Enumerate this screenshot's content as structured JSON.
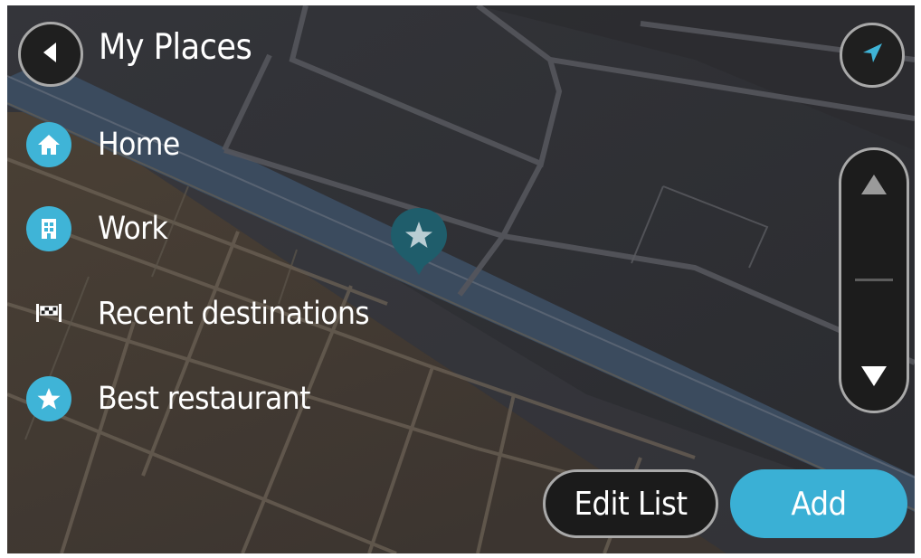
{
  "header": {
    "title": "My Places",
    "back_icon": "back-arrow-icon",
    "location_icon": "current-location-arrow-icon"
  },
  "list": {
    "items": [
      {
        "label": "Home",
        "icon": "home-icon"
      },
      {
        "label": "Work",
        "icon": "work-building-icon"
      },
      {
        "label": "Recent destinations",
        "icon": "checkered-flag-icon"
      },
      {
        "label": "Best restaurant",
        "icon": "star-icon"
      }
    ]
  },
  "scroll": {
    "up_icon": "scroll-up-arrow-icon",
    "down_icon": "scroll-down-arrow-icon"
  },
  "footer": {
    "edit_label": "Edit List",
    "add_label": "Add"
  },
  "map": {
    "marker_icon": "star-pin-icon"
  },
  "colors": {
    "accent": "#3ab0d5",
    "button_dark": "#1b1b1b",
    "button_border": "#a9a9a9",
    "text": "#ffffff"
  }
}
